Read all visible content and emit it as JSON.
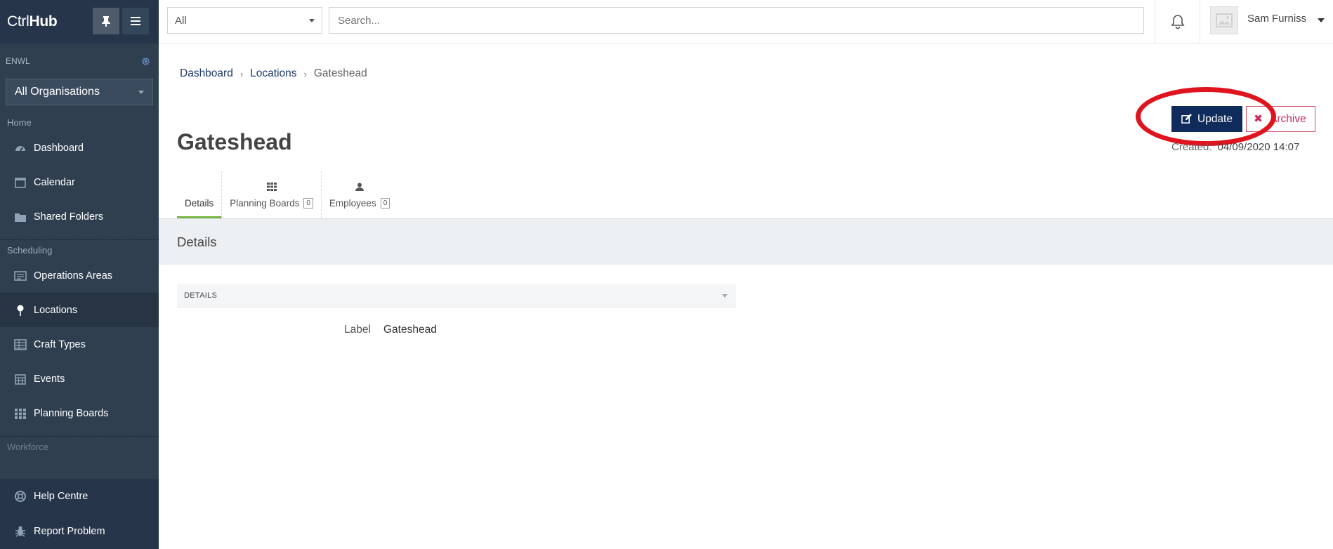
{
  "app": {
    "brand_prefix": "Ctrl",
    "brand_suffix": "Hub"
  },
  "sidebar": {
    "org_code": "ENWL",
    "org_select": "All Organisations",
    "sections": {
      "home": "Home",
      "scheduling": "Scheduling",
      "workforce": "Workforce"
    },
    "items": [
      {
        "label": "Dashboard",
        "icon": "dashboard-icon"
      },
      {
        "label": "Calendar",
        "icon": "calendar-icon"
      },
      {
        "label": "Shared Folders",
        "icon": "folder-icon"
      },
      {
        "label": "Operations Areas",
        "icon": "operations-icon"
      },
      {
        "label": "Locations",
        "icon": "location-pin-icon",
        "active": true
      },
      {
        "label": "Craft Types",
        "icon": "table-icon"
      },
      {
        "label": "Events",
        "icon": "calendar-grid-icon"
      },
      {
        "label": "Planning Boards",
        "icon": "grid-icon"
      }
    ],
    "footer": [
      {
        "label": "Help Centre",
        "icon": "lifebuoy-icon"
      },
      {
        "label": "Report Problem",
        "icon": "bug-icon"
      }
    ]
  },
  "topbar": {
    "scope": "All",
    "search_placeholder": "Search...",
    "user_name": "Sam Furniss"
  },
  "breadcrumb": {
    "dashboard": "Dashboard",
    "locations": "Locations",
    "current": "Gateshead"
  },
  "page": {
    "title": "Gateshead",
    "update_label": "Update",
    "archive_label": "Archive",
    "created_label": "Created:",
    "created_value": "04/09/2020 14:07"
  },
  "tabs": [
    {
      "label": "Details",
      "active": true
    },
    {
      "label": "Planning Boards",
      "count": "0"
    },
    {
      "label": "Employees",
      "count": "0"
    }
  ],
  "details": {
    "band_title": "Details",
    "panel_title": "DETAILS",
    "label_name": "Label",
    "label_value": "Gateshead"
  },
  "colors": {
    "sidebar_bg": "#2f3f50",
    "primary": "#0f2b5b",
    "danger": "#d0285a",
    "tab_active": "#7ab648",
    "highlight": "#e0141e"
  }
}
